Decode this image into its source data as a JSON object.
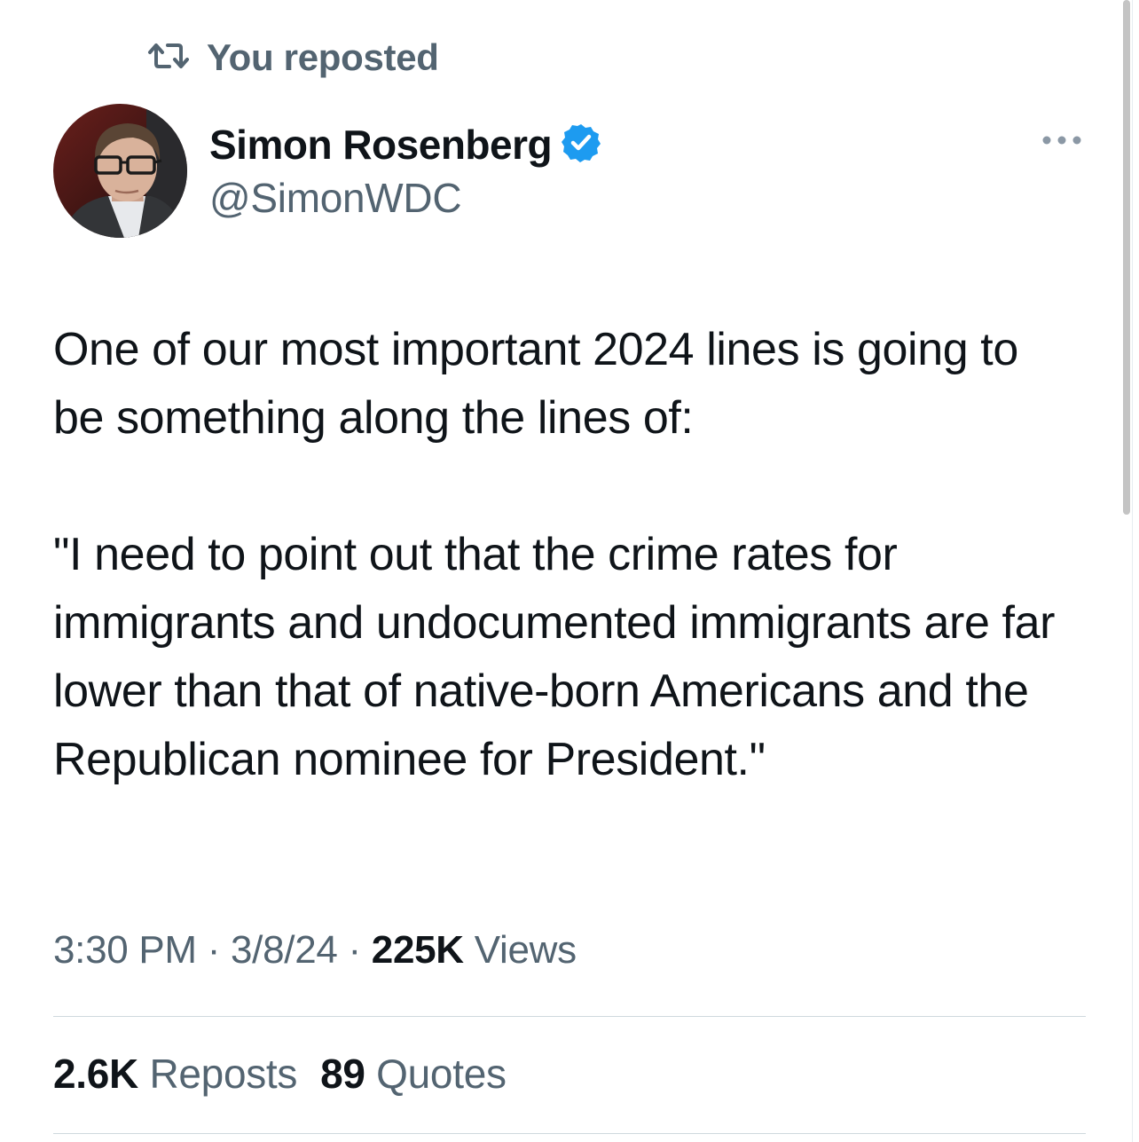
{
  "repost_banner": {
    "icon": "repost-icon",
    "label": "You reposted"
  },
  "author": {
    "avatar": "avatar",
    "name": "Simon Rosenberg",
    "verified_icon": "verified-badge-icon",
    "handle": "@SimonWDC"
  },
  "more_menu": {
    "icon": "more-options-icon"
  },
  "tweet": {
    "paragraphs": [
      "One of our most important 2024 lines is going to be something along the lines of:",
      "\"I need to point out that the crime rates for immigrants and undocumented immigrants are far lower than that of native-born Americans and the Republican nominee for President.\""
    ]
  },
  "meta": {
    "time": "3:30 PM",
    "date": "3/8/24",
    "views_count": "225K",
    "views_label": "Views",
    "separator": "·"
  },
  "stats": {
    "reposts_count": "2.6K",
    "reposts_label": "Reposts",
    "quotes_count": "89",
    "quotes_label": "Quotes"
  },
  "colors": {
    "text_primary": "#0f1419",
    "text_secondary": "#536471",
    "verified_blue": "#1d9bf0",
    "divider": "#cfd9de"
  }
}
